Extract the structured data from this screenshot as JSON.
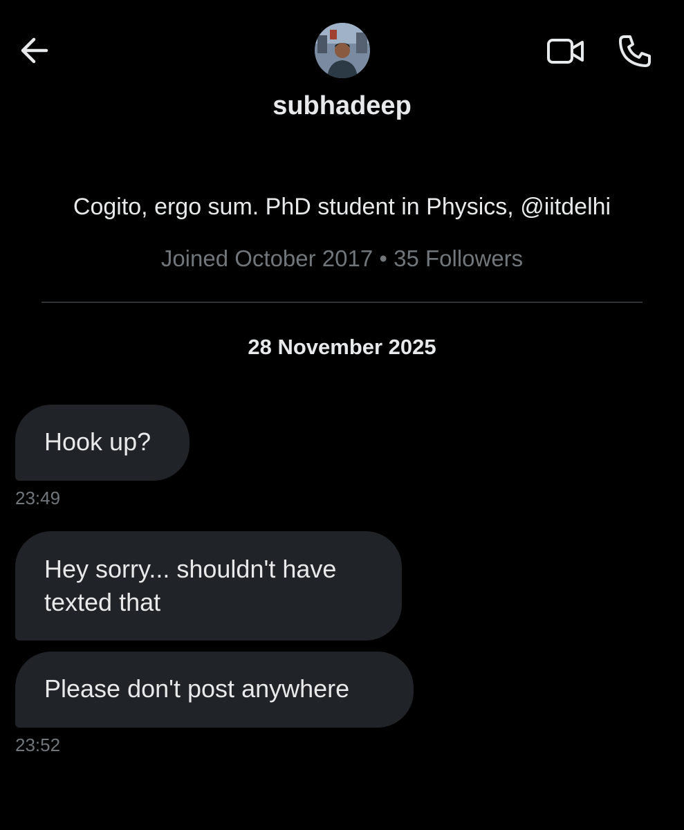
{
  "header": {
    "back_icon": "arrow-left-icon",
    "video_icon": "video-camera-icon",
    "call_icon": "phone-icon",
    "username": "subhadeep"
  },
  "profile": {
    "bio": "Cogito, ergo sum. PhD student in Physics, @iitdelhi",
    "meta": "Joined October 2017 • 35 Followers"
  },
  "conversation": {
    "date": "28 November 2025",
    "messages": [
      {
        "text": "Hook up?",
        "time": "23:49"
      },
      {
        "text": "Hey sorry... shouldn't have texted that",
        "time": ""
      },
      {
        "text": "Please don't post anywhere",
        "time": "23:52"
      }
    ]
  },
  "colors": {
    "background": "#000000",
    "bubble": "#202327",
    "text_primary": "#e7e9ea",
    "text_secondary": "#71767b"
  }
}
